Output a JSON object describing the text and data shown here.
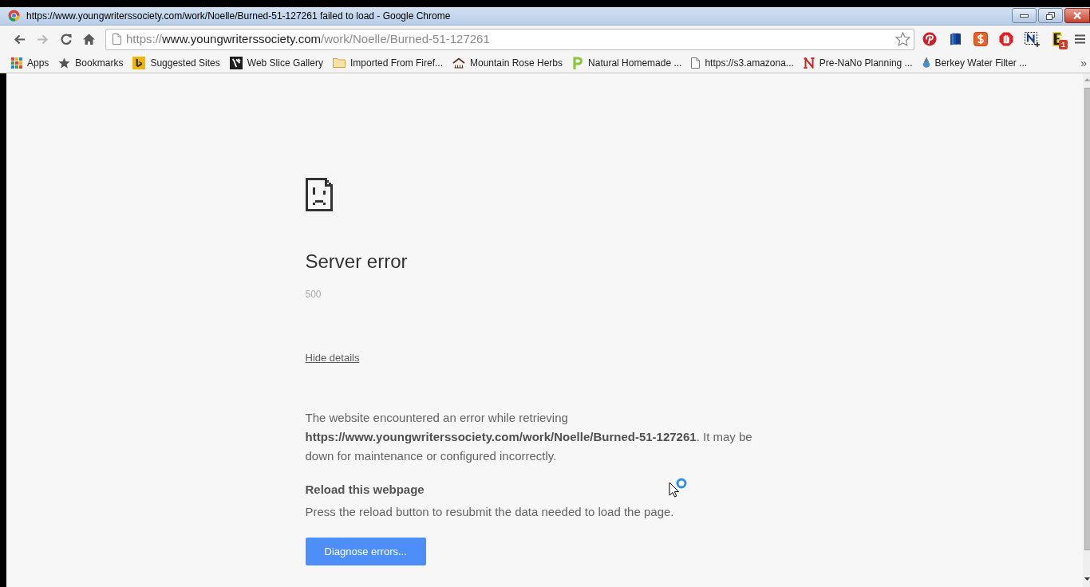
{
  "window": {
    "title": "https://www.youngwriterssociety.com/work/Noelle/Burned-51-127261 failed to load - Google Chrome"
  },
  "toolbar": {
    "nav_buttons": [
      {
        "kind": "back",
        "disabled": false
      },
      {
        "kind": "forward",
        "disabled": true
      },
      {
        "kind": "reload",
        "disabled": false
      },
      {
        "kind": "home",
        "disabled": false
      }
    ],
    "address": {
      "scheme": "https://",
      "host": "www.youngwriterssociety.com",
      "path": "/work/Noelle/Burned-51-127261"
    },
    "bookmarked": false,
    "extension_badge": "1"
  },
  "bookmarks_bar": {
    "items": [
      "Apps",
      "Bookmarks",
      "Suggested Sites",
      "Web Slice Gallery",
      "Imported From Firef...",
      "Mountain Rose Herbs",
      "Natural Homemade ...",
      "https://s3.amazona...",
      "Pre-NaNo Planning ...",
      "Berkey Water Filter ..."
    ],
    "overflow": "»"
  },
  "error_page": {
    "title": "Server error",
    "code": "500",
    "details_link": "Hide details",
    "details": "The website encountered an error while retrieving **https://www.youngwriterssociety.com/work/Noelle/Burned-51-127261**. It may be down for maintenance or configured incorrectly.",
    "suggestion_heading": "Reload this webpage",
    "suggestion": "Press the reload button to resubmit the data needed to load the page.",
    "button": "Diagnose errors..."
  }
}
